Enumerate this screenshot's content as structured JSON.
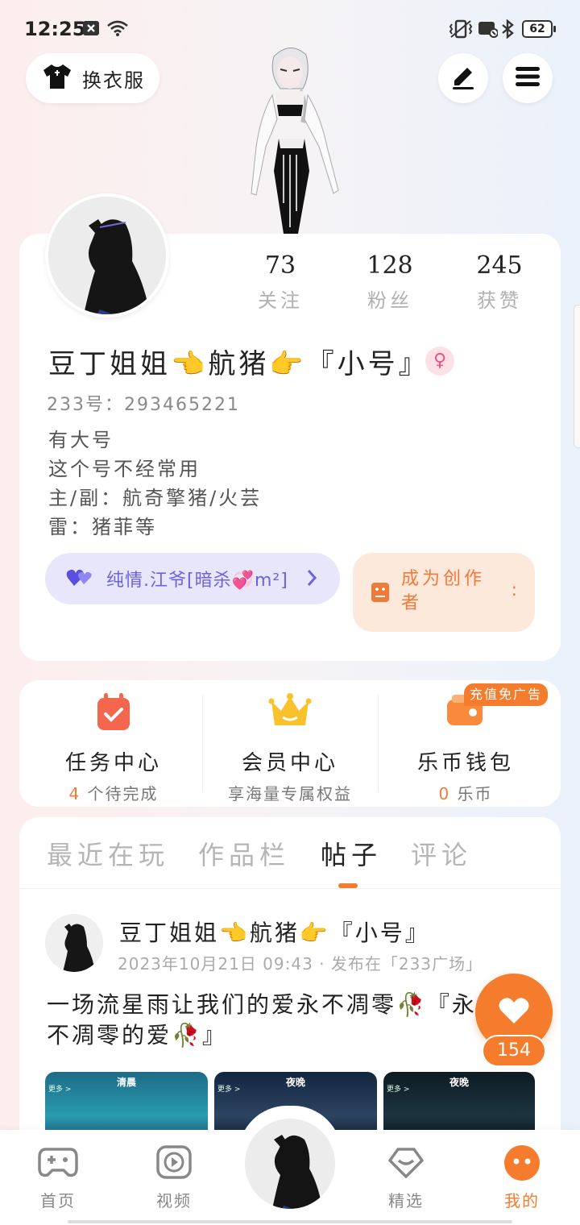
{
  "status_bar": {
    "time": "12:25",
    "battery": "62"
  },
  "top": {
    "outfit_label": "换衣服"
  },
  "profile": {
    "stats": [
      {
        "value": "73",
        "label": "关注"
      },
      {
        "value": "128",
        "label": "粉丝"
      },
      {
        "value": "245",
        "label": "获赞"
      }
    ],
    "nickname": "豆丁姐姐👈航猪👉『小号』",
    "gender_symbol": "♀",
    "uid": "233号：293465221",
    "bio": [
      "有大号",
      "这个号不经常用",
      "主/副：航奇擎猪/火芸",
      "雷：猪菲等"
    ],
    "fan_club": "纯情.江爷[暗杀💞m²]",
    "creator_label": "成为创作者",
    "creator_colon": ":"
  },
  "services": [
    {
      "title": "任务中心",
      "count": "4",
      "sub": "个待完成"
    },
    {
      "title": "会员中心",
      "count": "",
      "sub": "享海量专属权益"
    },
    {
      "title": "乐币钱包",
      "count": "0",
      "sub": "乐币"
    }
  ],
  "ad_badge": "充值免广告",
  "tabs": [
    "最近在玩",
    "作品栏",
    "帖子",
    "评论"
  ],
  "active_tab": "帖子",
  "post": {
    "author": "豆丁姐姐👈航猪👉『小号』",
    "meta": "2023年10月21日 09:43 · 发布在「233广场」",
    "text": "一场流星雨让我们的爱永不凋零🥀『永不凋零的爱🥀』",
    "images": [
      {
        "caption": "清晨",
        "chip": "更多 >"
      },
      {
        "caption": "夜晚",
        "chip": "更多 >"
      },
      {
        "caption": "夜晚",
        "chip": "更多 >"
      }
    ],
    "likes": "154"
  },
  "nav": [
    {
      "label": "首页"
    },
    {
      "label": "视频"
    },
    {
      "label": "精选"
    },
    {
      "label": "我的"
    }
  ],
  "colors": {
    "accent": "#f57c2c",
    "fan_purple": "#6c62e0",
    "gender_pink": "#f0508a"
  }
}
